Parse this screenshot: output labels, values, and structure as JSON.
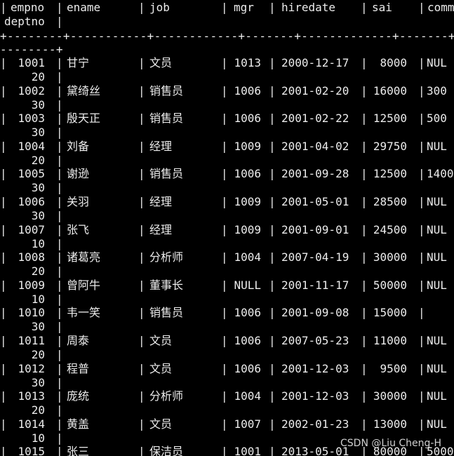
{
  "header": {
    "col1": "empno",
    "col2": "ename",
    "col3": "job",
    "col4": "mgr",
    "col5": "hiredate",
    "col6": "sai",
    "col7": "comm",
    "col8": "deptno"
  },
  "separator_line1": "+--------+-----------+------------+-------+-------------+-------+--------+",
  "separator_line2": "--------+",
  "rows": [
    {
      "empno": "1001",
      "ename": "甘宁",
      "job": "文员",
      "mgr": "1013",
      "hiredate": "2000-12-17",
      "sai": "8000",
      "comm": "NUL",
      "deptno": "20"
    },
    {
      "empno": "1002",
      "ename": "黛绮丝",
      "job": "销售员",
      "mgr": "1006",
      "hiredate": "2001-02-20",
      "sai": "16000",
      "comm": "300",
      "deptno": "30"
    },
    {
      "empno": "1003",
      "ename": "殷天正",
      "job": "销售员",
      "mgr": "1006",
      "hiredate": "2001-02-22",
      "sai": "12500",
      "comm": "500",
      "deptno": "30"
    },
    {
      "empno": "1004",
      "ename": "刘备",
      "job": "经理",
      "mgr": "1009",
      "hiredate": "2001-04-02",
      "sai": "29750",
      "comm": "NUL",
      "deptno": "20"
    },
    {
      "empno": "1005",
      "ename": "谢逊",
      "job": "销售员",
      "mgr": "1006",
      "hiredate": "2001-09-28",
      "sai": "12500",
      "comm": "1400",
      "deptno": "30"
    },
    {
      "empno": "1006",
      "ename": "关羽",
      "job": "经理",
      "mgr": "1009",
      "hiredate": "2001-05-01",
      "sai": "28500",
      "comm": "NUL",
      "deptno": "30"
    },
    {
      "empno": "1007",
      "ename": "张飞",
      "job": "经理",
      "mgr": "1009",
      "hiredate": "2001-09-01",
      "sai": "24500",
      "comm": "NUL",
      "deptno": "10"
    },
    {
      "empno": "1008",
      "ename": "诸葛亮",
      "job": "分析师",
      "mgr": "1004",
      "hiredate": "2007-04-19",
      "sai": "30000",
      "comm": "NUL",
      "deptno": "20"
    },
    {
      "empno": "1009",
      "ename": "曾阿牛",
      "job": "董事长",
      "mgr": "NULL",
      "hiredate": "2001-11-17",
      "sai": "50000",
      "comm": "NUL",
      "deptno": "10"
    },
    {
      "empno": "1010",
      "ename": "韦一笑",
      "job": "销售员",
      "mgr": "1006",
      "hiredate": "2001-09-08",
      "sai": "15000",
      "comm": "",
      "deptno": "30"
    },
    {
      "empno": "1011",
      "ename": "周泰",
      "job": "文员",
      "mgr": "1006",
      "hiredate": "2007-05-23",
      "sai": "11000",
      "comm": "NUL",
      "deptno": "20"
    },
    {
      "empno": "1012",
      "ename": "程普",
      "job": "文员",
      "mgr": "1006",
      "hiredate": "2001-12-03",
      "sai": "9500",
      "comm": "NUL",
      "deptno": "30"
    },
    {
      "empno": "1013",
      "ename": "庞统",
      "job": "分析师",
      "mgr": "1004",
      "hiredate": "2001-12-03",
      "sai": "30000",
      "comm": "NUL",
      "deptno": "20"
    },
    {
      "empno": "1014",
      "ename": "黄盖",
      "job": "文员",
      "mgr": "1007",
      "hiredate": "2002-01-23",
      "sai": "13000",
      "comm": "NUL",
      "deptno": "10"
    },
    {
      "empno": "1015",
      "ename": "张三",
      "job": "保洁员",
      "mgr": "1001",
      "hiredate": "2013-05-01",
      "sai": "80000",
      "comm": "5000",
      "deptno": ""
    }
  ],
  "watermark": "CSDN @Liu Cheng-H"
}
